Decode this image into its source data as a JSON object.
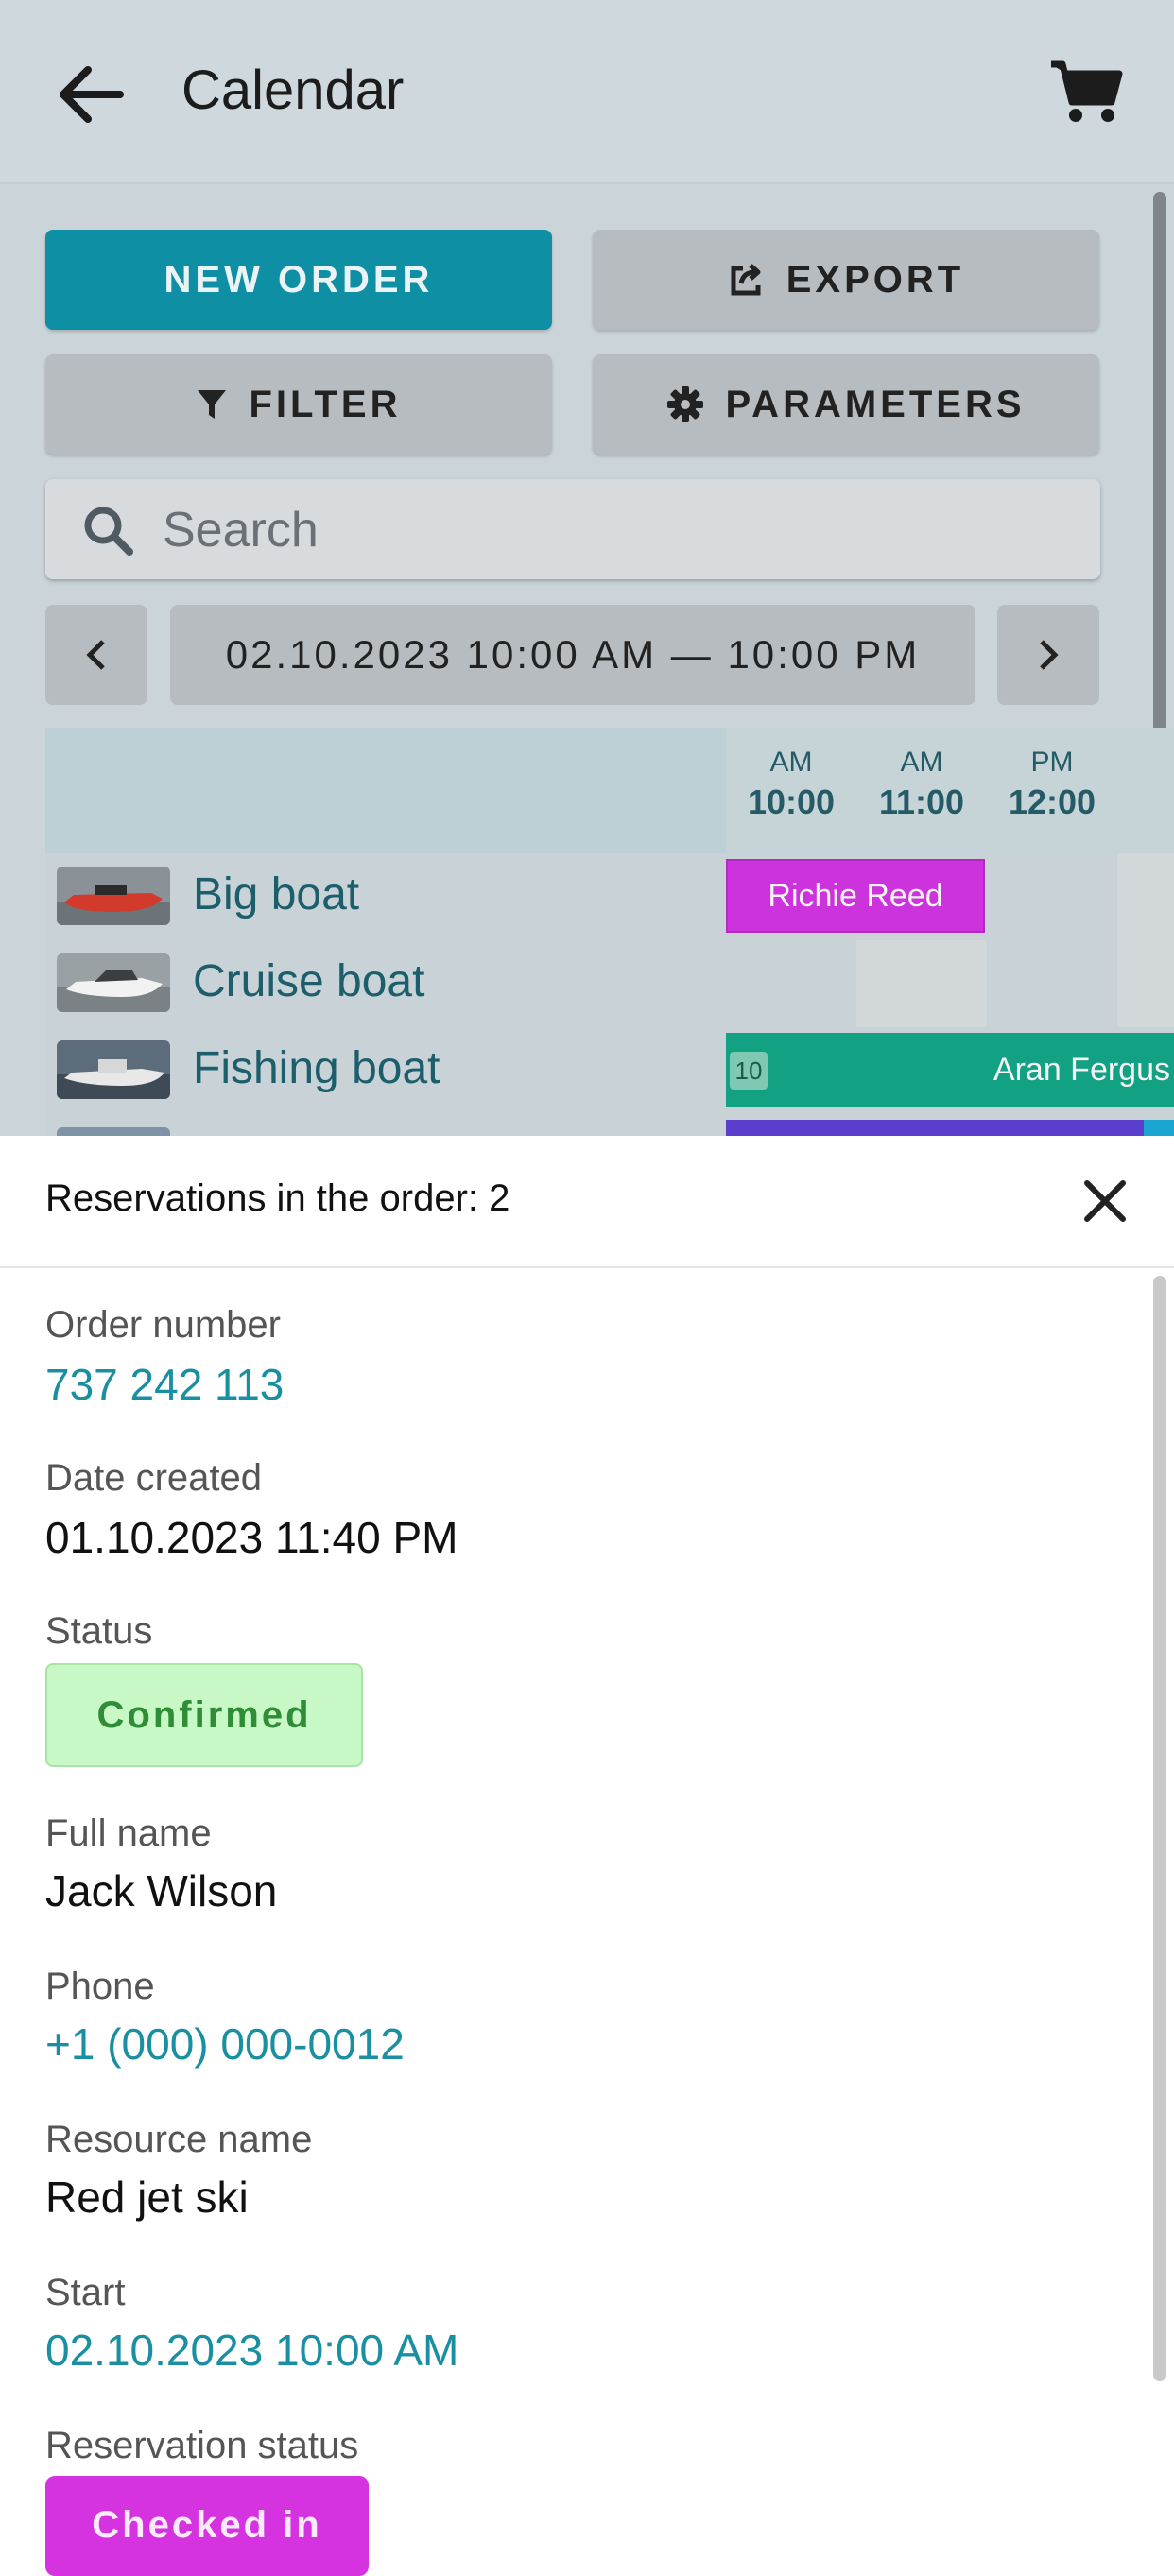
{
  "header": {
    "title": "Calendar"
  },
  "toolbar": {
    "new_order_label": "NEW ORDER",
    "export_label": "EXPORT",
    "filter_label": "FILTER",
    "parameters_label": "PARAMETERS"
  },
  "search": {
    "placeholder": "Search",
    "value": ""
  },
  "date_range": {
    "label": "02.10.2023 10:00 AM — 10:00 PM"
  },
  "timeline": {
    "hours": [
      {
        "ampm": "AM",
        "time": "10:00"
      },
      {
        "ampm": "AM",
        "time": "11:00"
      },
      {
        "ampm": "PM",
        "time": "12:00"
      }
    ]
  },
  "resources": [
    {
      "name": "Big boat"
    },
    {
      "name": "Cruise boat"
    },
    {
      "name": "Fishing boat"
    }
  ],
  "events": {
    "big_boat": {
      "label": "Richie Reed",
      "color": "#cc33dd"
    },
    "fishing_boat": {
      "label": "Aran Fergus",
      "badge": "10",
      "color": "#13a183"
    },
    "next_row_color": "#5b3ecb",
    "next_row_accent": "#1aa6d1"
  },
  "sheet": {
    "title": "Reservations in the order: 2",
    "fields": {
      "order_number_label": "Order number",
      "order_number": "737 242 113",
      "date_created_label": "Date created",
      "date_created": "01.10.2023 11:40 PM",
      "status_label": "Status",
      "status": "Confirmed",
      "full_name_label": "Full name",
      "full_name": "Jack Wilson",
      "phone_label": "Phone",
      "phone": "+1 (000) 000-0012",
      "resource_name_label": "Resource name",
      "resource_name": "Red jet ski",
      "start_label": "Start",
      "start": "02.10.2023 10:00 AM",
      "reservation_status_label": "Reservation status",
      "reservation_status": "Checked in"
    }
  },
  "colors": {
    "primary": "#0f8fa3",
    "link": "#1a8fa2",
    "confirmed_bg": "#c8f8c6",
    "checked_in_bg": "#d633e0"
  }
}
